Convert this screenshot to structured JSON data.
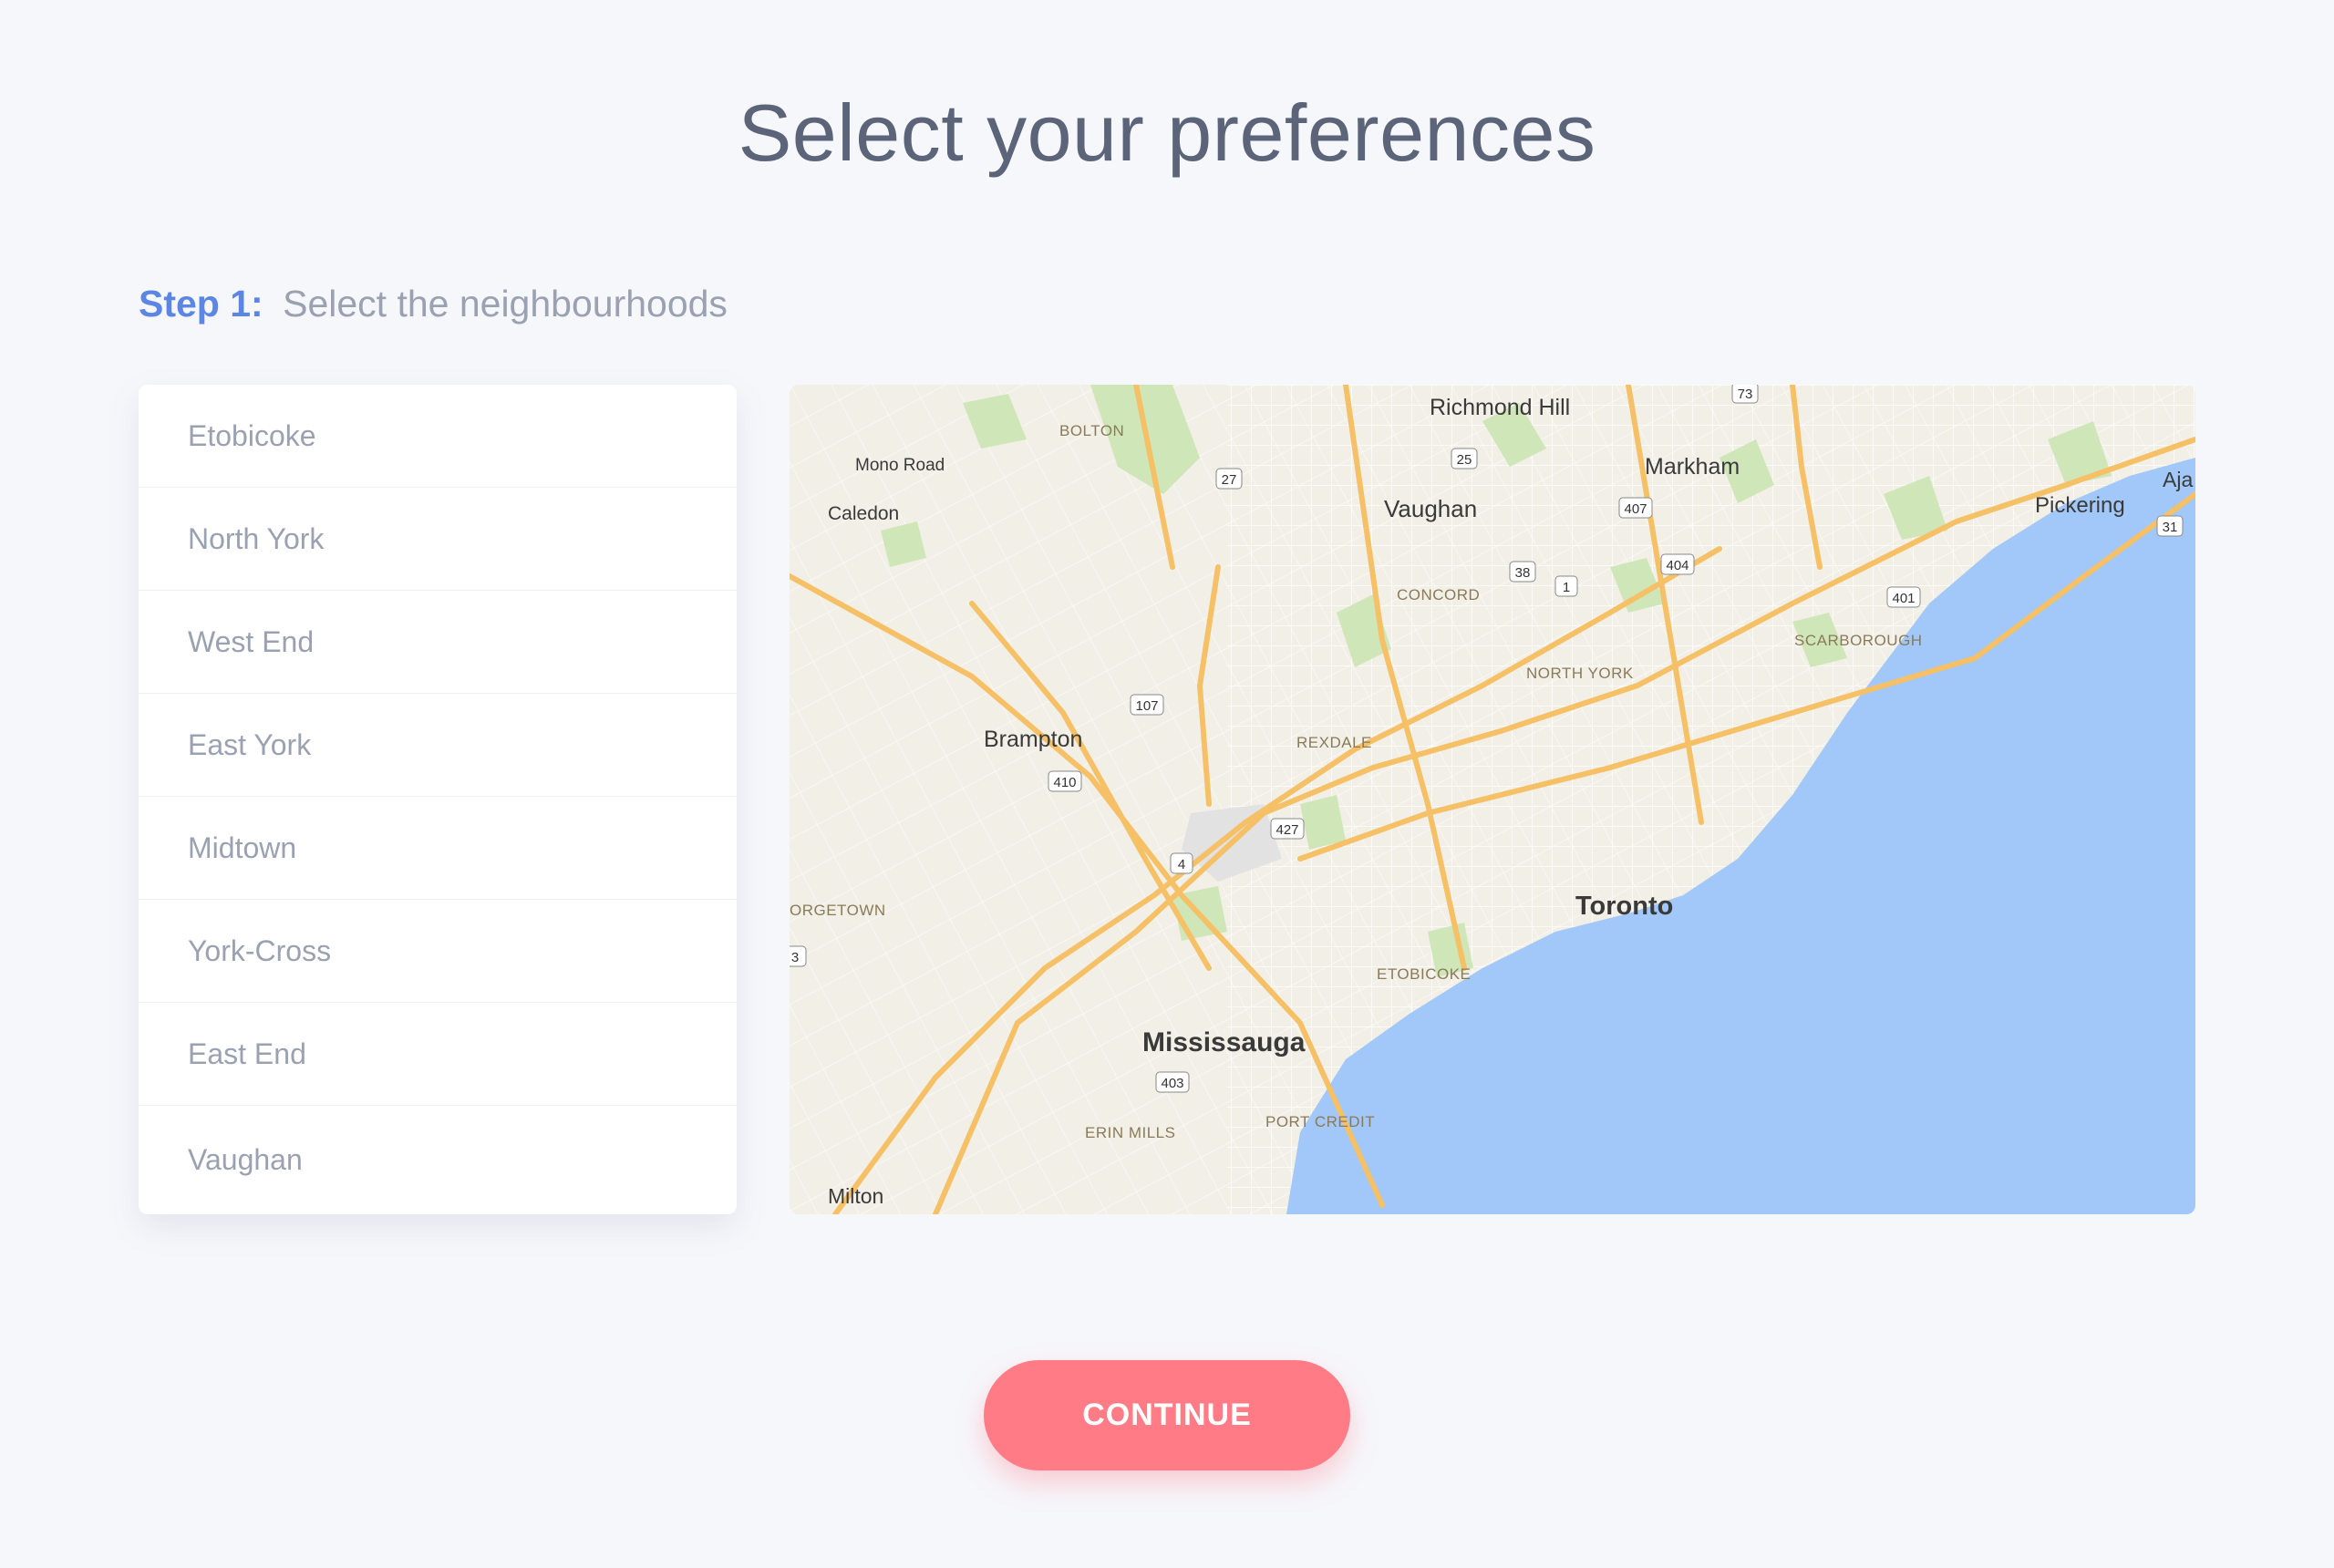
{
  "page": {
    "title": "Select your preferences"
  },
  "step": {
    "label": "Step 1:",
    "text": "Select the neighbourhoods"
  },
  "neighbourhoods": [
    "Etobicoke",
    "North York",
    "West End",
    "East York",
    "Midtown",
    "York-Cross",
    "East End",
    "Vaughan"
  ],
  "map": {
    "cities": [
      "Richmond Hill",
      "Markham",
      "Vaughan",
      "Pickering",
      "Brampton",
      "Toronto",
      "Mississauga",
      "Milton",
      "Caledon",
      "Mono Road",
      "Aja"
    ],
    "districts": [
      "BOLTON",
      "CONCORD",
      "NORTH YORK",
      "SCARBOROUGH",
      "REXDALE",
      "ETOBICOKE",
      "PORT CREDIT",
      "ERIN MILLS",
      "ORGETOWN"
    ],
    "highways": [
      "73",
      "25",
      "27",
      "407",
      "404",
      "38",
      "1",
      "401",
      "31",
      "107",
      "410",
      "427",
      "4",
      "403",
      "3"
    ],
    "colors": {
      "land": "#f1efe6",
      "water": "#a1c8f9",
      "highway": "#f5c066",
      "park": "#cfe6b8"
    }
  },
  "actions": {
    "continue_label": "CONTINUE"
  },
  "colors": {
    "accent": "#5b86e5",
    "button": "#ff7b86",
    "background": "#f6f7fb"
  }
}
